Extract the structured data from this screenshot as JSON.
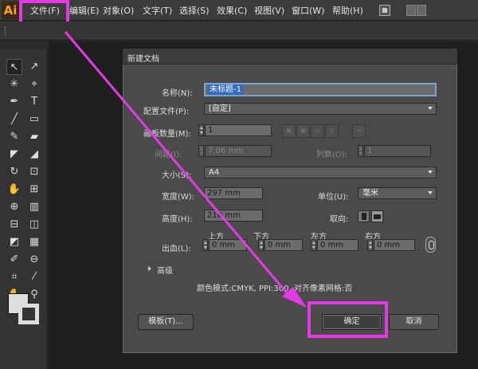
{
  "app": {
    "logo": "Ai"
  },
  "menu": {
    "items": [
      {
        "label": "文件(F)"
      },
      {
        "label": "编辑(E)"
      },
      {
        "label": "对象(O)"
      },
      {
        "label": "文字(T)"
      },
      {
        "label": "选择(S)"
      },
      {
        "label": "效果(C)"
      },
      {
        "label": "视图(V)"
      },
      {
        "label": "窗口(W)"
      },
      {
        "label": "帮助(H)"
      }
    ]
  },
  "tools": {
    "glyphs": [
      "↖",
      "↗",
      "✳",
      "⌖",
      "✒",
      "T",
      "╱",
      "▭",
      "✎",
      "▰",
      "◤",
      "◢",
      "↻",
      "⊡",
      "✋",
      "⊞",
      "⊕",
      "▥",
      "⊟",
      "◫",
      "◩",
      "▦",
      "✐",
      "⊖",
      "⌗",
      "⁄",
      "✋",
      "⚲"
    ]
  },
  "dialog": {
    "title": "新建文档",
    "name_label": "名称(N):",
    "name_value": "未标题-1",
    "profile_label": "配置文件(P):",
    "profile_value": "[自定]",
    "artboards_label": "画板数量(M):",
    "artboards_value": "1",
    "spacing_label": "间距(I):",
    "spacing_value": "7.06 mm",
    "columns_label": "列数(O):",
    "columns_value": "1",
    "size_label": "大小(S):",
    "size_value": "A4",
    "width_label": "宽度(W):",
    "width_value": "297 mm",
    "units_label": "单位(U):",
    "units_value": "毫米",
    "height_label": "高度(H):",
    "height_value": "210 mm",
    "orientation_label": "取向:",
    "bleed_label": "出血(L):",
    "bleed_top_label": "上方",
    "bleed_top_value": "0 mm",
    "bleed_bottom_label": "下方",
    "bleed_bottom_value": "0 mm",
    "bleed_left_label": "左方",
    "bleed_left_value": "0 mm",
    "bleed_right_label": "右方",
    "bleed_right_value": "0 mm",
    "advanced_label": "高级",
    "summary": "颜色模式:CMYK, PPI:300, 对齐像素网格:否",
    "templates_button": "模板(T)...",
    "ok_button": "确定",
    "cancel_button": "取消"
  },
  "annotation": {
    "color": "#e23be6"
  }
}
